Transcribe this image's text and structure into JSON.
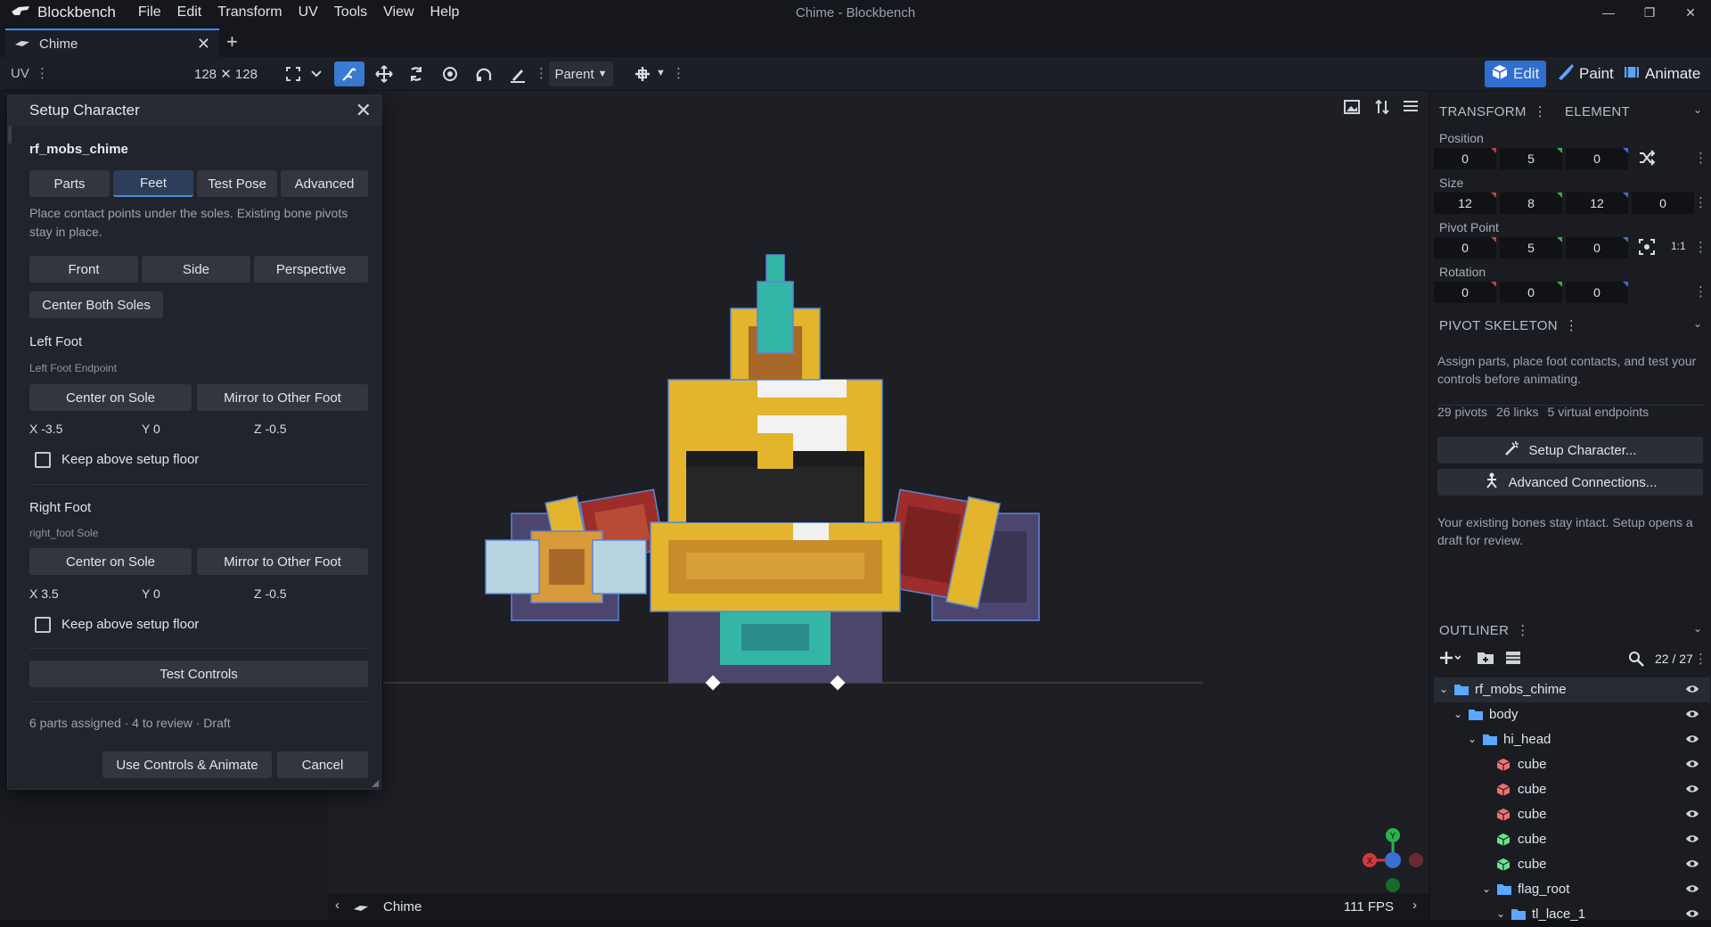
{
  "app": {
    "brand": "Blockbench",
    "window_title": "Chime - Blockbench",
    "menu": [
      "File",
      "Edit",
      "Transform",
      "UV",
      "Tools",
      "View",
      "Help"
    ]
  },
  "tab": {
    "label": "Chime"
  },
  "toolbar": {
    "uv_label": "UV",
    "uv_size": "128 ✕ 128",
    "parent_label": "Parent",
    "modes": {
      "edit": "Edit",
      "paint": "Paint",
      "animate": "Animate"
    }
  },
  "dialog": {
    "title": "Setup Character",
    "model_name": "rf_mobs_chime",
    "tabs": [
      "Parts",
      "Feet",
      "Test Pose",
      "Advanced"
    ],
    "active_tab": "Feet",
    "instructions": "Place contact points under the soles. Existing bone pivots stay in place.",
    "views": [
      "Front",
      "Side",
      "Perspective"
    ],
    "center_both": "Center Both Soles",
    "left_foot": {
      "title": "Left Foot",
      "subtitle": "Left Foot Endpoint",
      "center": "Center on Sole",
      "mirror": "Mirror to Other Foot",
      "x": "X -3.5",
      "y": "Y 0",
      "z": "Z -0.5",
      "keep": "Keep above setup floor"
    },
    "right_foot": {
      "title": "Right Foot",
      "subtitle": "right_foot Sole",
      "center": "Center on Sole",
      "mirror": "Mirror to Other Foot",
      "x": "X 3.5",
      "y": "Y 0",
      "z": "Z -0.5",
      "keep": "Keep above setup floor"
    },
    "test_controls": "Test Controls",
    "status": "6 parts assigned · 4 to review · Draft",
    "use_controls": "Use Controls & Animate",
    "cancel": "Cancel"
  },
  "statusbar": {
    "model": "Chime",
    "fps": "111 FPS"
  },
  "transform": {
    "tab_transform": "TRANSFORM",
    "tab_element": "ELEMENT",
    "position_label": "Position",
    "position": [
      "0",
      "5",
      "0"
    ],
    "size_label": "Size",
    "size": [
      "12",
      "8",
      "12",
      "0"
    ],
    "pivot_label": "Pivot Point",
    "pivot": [
      "0",
      "5",
      "0"
    ],
    "pivot_ratio": "1:1",
    "rotation_label": "Rotation",
    "rotation": [
      "0",
      "0",
      "0"
    ]
  },
  "pivot_skeleton": {
    "title": "PIVOT SKELETON",
    "description": "Assign parts, place foot contacts, and test your controls before animating.",
    "stats": [
      "29 pivots",
      "26 links",
      "5 virtual endpoints"
    ],
    "setup_button": "Setup Character...",
    "advanced_button": "Advanced Connections...",
    "note": "Your existing bones stay intact. Setup opens a draft for review."
  },
  "outliner": {
    "title": "OUTLINER",
    "count": "22 / 27",
    "items": [
      {
        "label": "rf_mobs_chime",
        "type": "folder"
      },
      {
        "label": "body",
        "type": "folder"
      },
      {
        "label": "hi_head",
        "type": "folder"
      },
      {
        "label": "cube",
        "type": "cube-red"
      },
      {
        "label": "cube",
        "type": "cube-red"
      },
      {
        "label": "cube",
        "type": "cube-red"
      },
      {
        "label": "cube",
        "type": "cube-green"
      },
      {
        "label": "cube",
        "type": "cube-green"
      },
      {
        "label": "flag_root",
        "type": "folder"
      },
      {
        "label": "tl_lace_1",
        "type": "folder"
      }
    ]
  },
  "gizmo": {
    "x": "X",
    "y": "Y"
  },
  "colors": {
    "accent": "#3a7bd5",
    "gold": "#e3b52c",
    "teal": "#34b6a6",
    "purple": "#4c466e",
    "red": "#9c2d2a"
  }
}
